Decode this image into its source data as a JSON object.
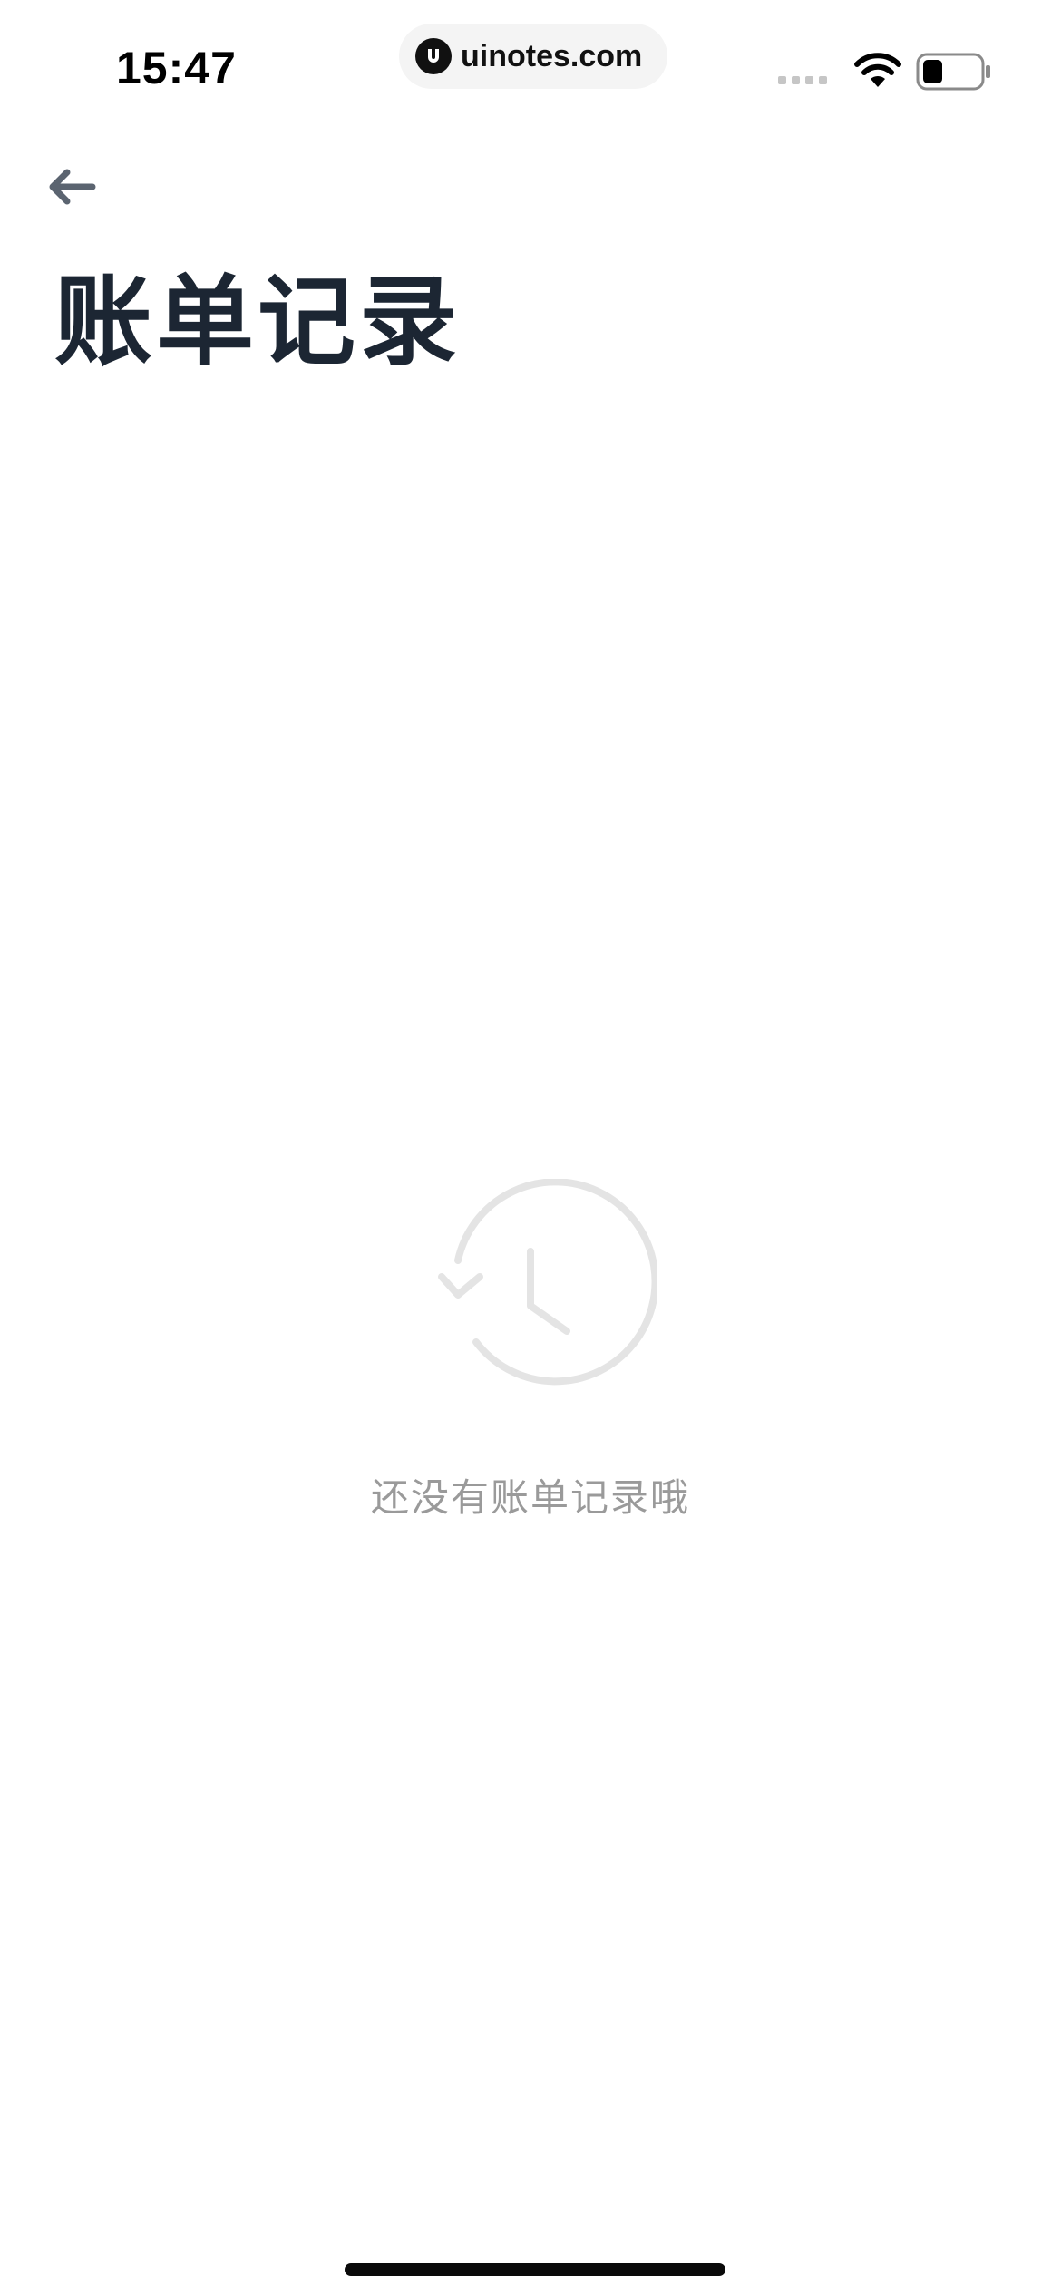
{
  "status_bar": {
    "time": "15:47",
    "url": "uinotes.com",
    "icons": [
      "signal-icon",
      "wifi-icon",
      "battery-icon"
    ],
    "battery_level": 0.35
  },
  "header": {
    "back_icon": "arrow-left-icon",
    "title": "账单记录"
  },
  "empty_state": {
    "icon": "history-clock-icon",
    "message": "还没有账单记录哦"
  },
  "colors": {
    "title": "#1c2633",
    "empty_text": "#9a9a9a",
    "empty_icon": "#e4e4e4",
    "back_icon": "#5b6470"
  }
}
